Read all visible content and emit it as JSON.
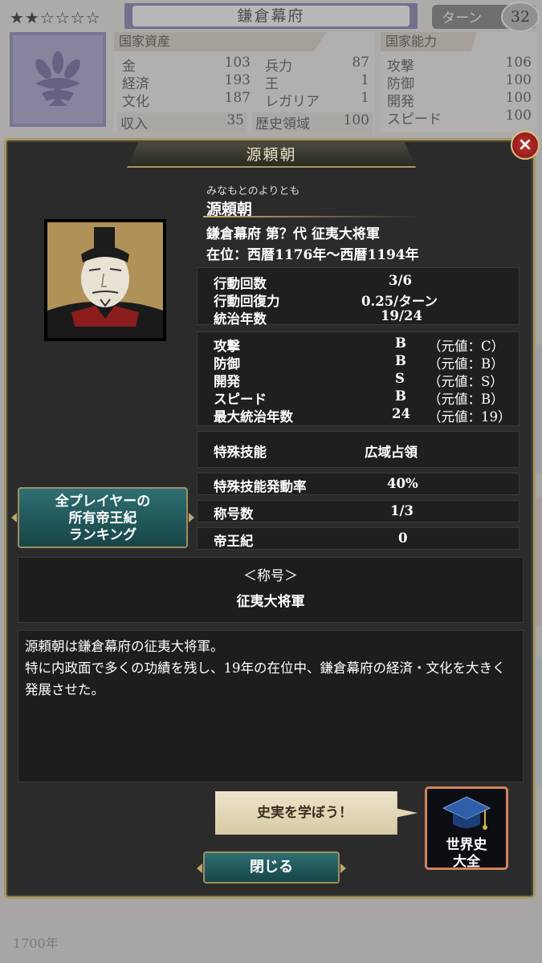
{
  "header": {
    "stars": "★★☆☆☆☆",
    "nation_name": "鎌倉幕府",
    "turn_label": "ターン",
    "turn_number": "32"
  },
  "resources": {
    "title": "国家資産",
    "rows": [
      {
        "label": "金",
        "value": "103"
      },
      {
        "label": "経済",
        "value": "193"
      },
      {
        "label": "文化",
        "value": "187"
      }
    ],
    "rows2": [
      {
        "label": "兵力",
        "value": "87"
      },
      {
        "label": "王",
        "value": "1"
      },
      {
        "label": "レガリア",
        "value": "1"
      }
    ],
    "income_label": "収入",
    "income_value": "35",
    "history_label": "歴史領域",
    "history_value": "100"
  },
  "abilities": {
    "title": "国家能力",
    "rows": [
      {
        "label": "攻撃",
        "value": "106"
      },
      {
        "label": "防御",
        "value": "100"
      },
      {
        "label": "開発",
        "value": "100"
      },
      {
        "label": "スピード",
        "value": "100"
      }
    ]
  },
  "bottom_strip_text": "1700年",
  "modal": {
    "title": "源頼朝",
    "close_icon": "×",
    "furigana": "みなもとのよりとも",
    "name": "源頼朝",
    "subtitle": "鎌倉幕府 第？代 征夷大将軍",
    "reign": "在位：西暦1176年〜西暦1194年",
    "action": {
      "count_label": "行動回数",
      "count_value": "3/6",
      "recover_label": "行動回復力",
      "recover_value": "0.25/ターン",
      "years_label": "統治年数",
      "years_value": "19/24"
    },
    "stats": [
      {
        "label": "攻撃",
        "grade": "B",
        "orig": "（元値：C）"
      },
      {
        "label": "防御",
        "grade": "B",
        "orig": "（元値：B）"
      },
      {
        "label": "開発",
        "grade": "S",
        "orig": "（元値：S）"
      },
      {
        "label": "スピード",
        "grade": "B",
        "orig": "（元値：B）"
      },
      {
        "label": "最大統治年数",
        "grade": "24",
        "orig": "（元値：19）"
      }
    ],
    "skill_label": "特殊技能",
    "skill_value": "広域占領",
    "skill_rate_label": "特殊技能発動率",
    "skill_rate_value": "40%",
    "titles_count_label": "称号数",
    "titles_count_value": "1/3",
    "record_label": "帝王紀",
    "record_value": "0",
    "ranking_button": {
      "line1": "全プレイヤーの",
      "line2": "所有帝王紀",
      "line3": "ランキング"
    },
    "title_section_heading": "＜称号＞",
    "title_section_value": "征夷大将軍",
    "description_line1": "源頼朝は鎌倉幕府の征夷大将軍。",
    "description_line2": "特に内政面で多くの功績を残し、19年の在位中、鎌倉幕府の経済・文化を大きく発展させた。",
    "learn_button": "史実を学ぼう！",
    "world_history_line1": "世界史",
    "world_history_line2": "大全",
    "close_button": "閉じる"
  }
}
